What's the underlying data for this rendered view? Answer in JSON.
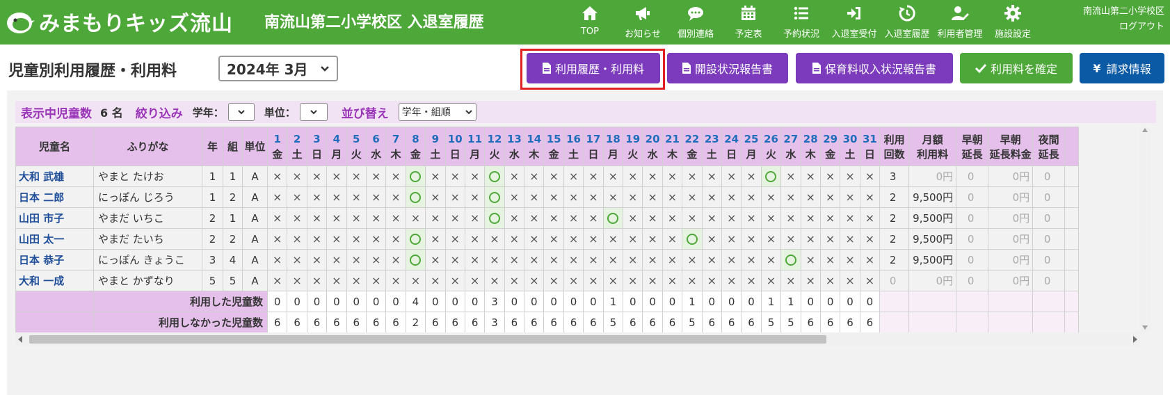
{
  "header": {
    "logo_text": "みまもりキッズ流山",
    "site_title": "南流山第二小学校区 入退室履歴",
    "nav": [
      {
        "label": "TOP",
        "icon": "home-icon"
      },
      {
        "label": "お知らせ",
        "icon": "megaphone-icon"
      },
      {
        "label": "個別連絡",
        "icon": "chat-icon"
      },
      {
        "label": "予定表",
        "icon": "calendar-icon"
      },
      {
        "label": "予約状況",
        "icon": "list-icon"
      },
      {
        "label": "入退室受付",
        "icon": "sign-in-icon"
      },
      {
        "label": "入退室履歴",
        "icon": "history-icon"
      },
      {
        "label": "利用者管理",
        "icon": "user-edit-icon"
      },
      {
        "label": "施設設定",
        "icon": "gear-icon"
      }
    ],
    "user_name": "南流山第二小学校区",
    "logout": "ログアウト"
  },
  "toolbar": {
    "page_title": "児童別利用履歴・利用料",
    "month": "2024年 3月",
    "buttons": [
      "利用履歴・利用料",
      "開設状況報告書",
      "保育料収入状況報告書",
      "利用料を確定",
      "請求情報"
    ]
  },
  "filter": {
    "shown_label": "表示中児童数",
    "shown_count": "6 名",
    "narrow_label": "絞り込み",
    "grade_label": "学年：",
    "unit_label": "単位：",
    "sort_label": "並び替え",
    "sort_value": "学年・組順"
  },
  "table": {
    "headers": {
      "name": "児童名",
      "kana": "ふりがな",
      "grade": "年",
      "class": "組",
      "unit": "単位",
      "uses_1": "利用",
      "uses_2": "回数",
      "monthly_1": "月額",
      "monthly_2": "利用料",
      "early_1": "早朝",
      "early_2": "延長",
      "early_fee_1": "早朝",
      "early_fee_2": "延長料金",
      "night_1": "夜間",
      "night_2": "延長"
    },
    "days": [
      "1",
      "2",
      "3",
      "4",
      "5",
      "6",
      "7",
      "8",
      "9",
      "10",
      "11",
      "12",
      "13",
      "14",
      "15",
      "16",
      "17",
      "18",
      "19",
      "20",
      "21",
      "22",
      "23",
      "24",
      "25",
      "26",
      "27",
      "28",
      "29",
      "30",
      "31"
    ],
    "weekdays": [
      "金",
      "土",
      "日",
      "月",
      "火",
      "水",
      "木",
      "金",
      "土",
      "日",
      "月",
      "火",
      "水",
      "木",
      "金",
      "土",
      "日",
      "月",
      "火",
      "水",
      "木",
      "金",
      "土",
      "日",
      "月",
      "火",
      "水",
      "木",
      "金",
      "土",
      "日"
    ],
    "rows": [
      {
        "name": "大和 武雄",
        "kana": "やまと たけお",
        "grade": "1",
        "class": "1",
        "unit": "A",
        "attend": [
          8,
          12,
          26
        ],
        "uses": "3",
        "monthly": "0円",
        "early": "0",
        "early_fee": "0円",
        "night": "0"
      },
      {
        "name": "日本 二郎",
        "kana": "にっぽん じろう",
        "grade": "1",
        "class": "2",
        "unit": "A",
        "attend": [
          8,
          12
        ],
        "uses": "2",
        "monthly": "9,500円",
        "early": "0",
        "early_fee": "0円",
        "night": "0"
      },
      {
        "name": "山田 市子",
        "kana": "やまだ いちこ",
        "grade": "2",
        "class": "1",
        "unit": "A",
        "attend": [
          12,
          18
        ],
        "uses": "2",
        "monthly": "9,500円",
        "early": "0",
        "early_fee": "0円",
        "night": "0"
      },
      {
        "name": "山田 太一",
        "kana": "やまだ たいち",
        "grade": "2",
        "class": "2",
        "unit": "A",
        "attend": [
          8,
          22
        ],
        "uses": "2",
        "monthly": "9,500円",
        "early": "0",
        "early_fee": "0円",
        "night": "0"
      },
      {
        "name": "日本 恭子",
        "kana": "にっぽん きょうこ",
        "grade": "3",
        "class": "4",
        "unit": "A",
        "attend": [
          8,
          27
        ],
        "uses": "2",
        "monthly": "9,500円",
        "early": "0",
        "early_fee": "0円",
        "night": "0"
      },
      {
        "name": "大和 一成",
        "kana": "やまと かずなり",
        "grade": "5",
        "class": "5",
        "unit": "A",
        "attend": [],
        "uses": "0",
        "monthly": "0円",
        "early": "0",
        "early_fee": "0円",
        "night": "0"
      }
    ],
    "cross_mark": "×",
    "used_label": "利用した児童数",
    "used_counts": [
      "0",
      "0",
      "0",
      "0",
      "0",
      "0",
      "0",
      "4",
      "0",
      "0",
      "0",
      "3",
      "0",
      "0",
      "0",
      "0",
      "0",
      "1",
      "0",
      "0",
      "0",
      "1",
      "0",
      "0",
      "0",
      "1",
      "1",
      "0",
      "0",
      "0",
      "0"
    ],
    "unused_label": "利用しなかった児童数",
    "unused_counts": [
      "6",
      "6",
      "6",
      "6",
      "6",
      "6",
      "6",
      "2",
      "6",
      "6",
      "6",
      "3",
      "6",
      "6",
      "6",
      "6",
      "6",
      "5",
      "6",
      "6",
      "6",
      "5",
      "6",
      "6",
      "6",
      "5",
      "5",
      "6",
      "6",
      "6",
      "6"
    ]
  },
  "colors": {
    "header_green": "#4ea839",
    "purple": "#7c3bbd",
    "blue": "#0b5aa6",
    "highlight_red": "#e02020",
    "table_header": "#e4c0ea"
  }
}
